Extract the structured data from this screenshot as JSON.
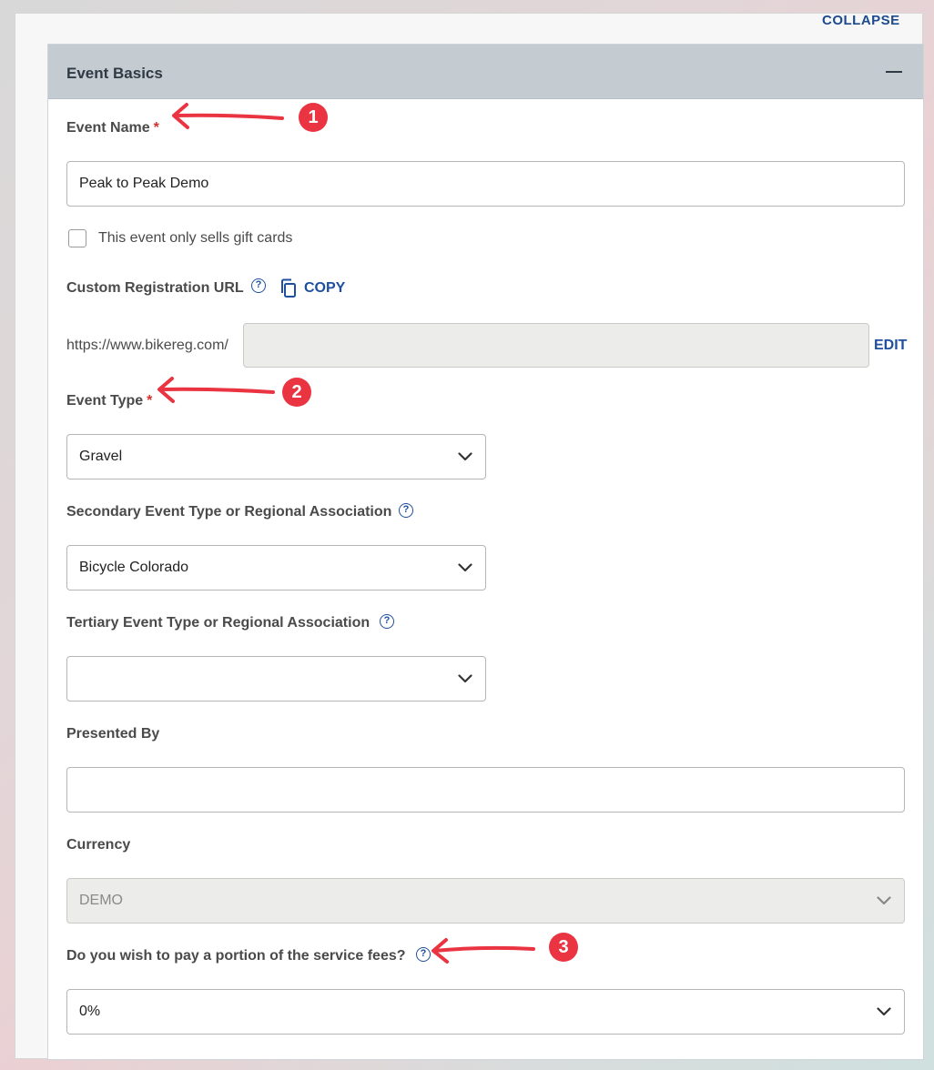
{
  "header": {
    "collapse_all_label": "COLLAPSE ALL",
    "section_title": "Event Basics"
  },
  "fields": {
    "event_name": {
      "label": "Event Name",
      "required_mark": "*",
      "value": "Peak to Peak Demo"
    },
    "gift_cards": {
      "label": "This event only sells gift cards",
      "checked": false
    },
    "custom_url": {
      "label": "Custom Registration URL",
      "copy_label": "COPY",
      "prefix": "https://www.bikereg.com/",
      "value": "",
      "edit_label": "EDIT"
    },
    "event_type": {
      "label": "Event Type",
      "required_mark": "*",
      "value": "Gravel"
    },
    "secondary_type": {
      "label": "Secondary Event Type or Regional Association",
      "value": "Bicycle Colorado"
    },
    "tertiary_type": {
      "label": "Tertiary Event Type or Regional Association",
      "value": ""
    },
    "presented_by": {
      "label": "Presented By",
      "value": ""
    },
    "currency": {
      "label": "Currency",
      "value": "DEMO"
    },
    "service_fees": {
      "label": "Do you wish to pay a portion of the service fees?",
      "value": "0%"
    }
  },
  "annotations": [
    "1",
    "2",
    "3"
  ],
  "colors": {
    "accent": "#1f4fa0",
    "required": "#d9302b",
    "annotation": "#ea3441",
    "header_bg": "#c4cbd1"
  },
  "icons": {
    "help": "help-circle-icon",
    "copy": "copy-icon",
    "chevron": "chevron-down-icon",
    "collapse": "minus-icon"
  }
}
